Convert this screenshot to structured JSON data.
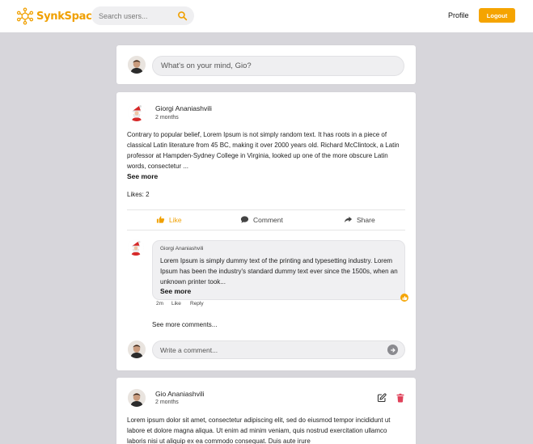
{
  "app": {
    "name": "SynkSpace",
    "accent": "#f5a400"
  },
  "header": {
    "search_placeholder": "Search users...",
    "profile_label": "Profile",
    "logout_label": "Logout"
  },
  "composer": {
    "placeholder": "What's on your mind, Gio?"
  },
  "posts": [
    {
      "author": "Giorgi Ananiashvili",
      "time": "2 months",
      "body": "Contrary to popular belief, Lorem Ipsum is not simply random text. It has roots in a piece of classical Latin literature from 45 BC, making it over 2000 years old. Richard McClintock, a Latin professor at Hampden-Sydney College in Virginia, looked up one of the more obscure Latin words, consectetur ...",
      "see_more": "See more",
      "likes": "Likes: 2",
      "actions": {
        "like": "Like",
        "comment": "Comment",
        "share": "Share"
      },
      "comments": [
        {
          "author": "Giorgi Ananiashvili",
          "text": "Lorem Ipsum is simply dummy text of the printing and typesetting industry. Lorem Ipsum has been the industry's standard dummy text ever since the 1500s, when an unknown printer took...",
          "see_more": "See more",
          "time": "2m",
          "like": "Like",
          "reply": "Reply"
        }
      ],
      "see_more_comments": "See more comments...",
      "comment_placeholder": "Write a comment..."
    },
    {
      "author": "Gio Ananiashvili",
      "time": "2 months",
      "body": "Lorem ipsum dolor sit amet, consectetur adipiscing elit, sed do eiusmod tempor incididunt ut labore et dolore magna aliqua. Ut enim ad minim veniam, quis nostrud exercitation ullamco laboris nisi ut aliquip ex ea commodo consequat. Duis aute irure"
    }
  ]
}
